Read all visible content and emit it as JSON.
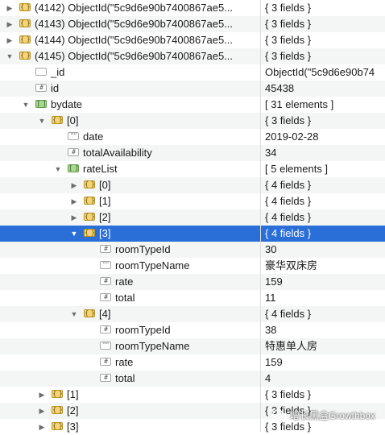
{
  "rows": [
    {
      "depth": 0,
      "arrow": "right",
      "icon": "obj",
      "key": "(4142) ObjectId(\"5c9d6e90b7400867ae5...",
      "val": "{ 3 fields }"
    },
    {
      "depth": 0,
      "arrow": "right",
      "icon": "obj",
      "key": "(4143) ObjectId(\"5c9d6e90b7400867ae5...",
      "val": "{ 3 fields }"
    },
    {
      "depth": 0,
      "arrow": "right",
      "icon": "obj",
      "key": "(4144) ObjectId(\"5c9d6e90b7400867ae5...",
      "val": "{ 3 fields }"
    },
    {
      "depth": 0,
      "arrow": "down",
      "icon": "obj",
      "key": "(4145) ObjectId(\"5c9d6e90b7400867ae5...",
      "val": "{ 3 fields }"
    },
    {
      "depth": 1,
      "arrow": "none",
      "icon": "oid",
      "key": "_id",
      "val": "ObjectId(\"5c9d6e90b74"
    },
    {
      "depth": 1,
      "arrow": "none",
      "icon": "num",
      "key": "id",
      "val": "45438"
    },
    {
      "depth": 1,
      "arrow": "down",
      "icon": "arr",
      "key": "bydate",
      "val": "[ 31 elements ]"
    },
    {
      "depth": 2,
      "arrow": "down",
      "icon": "obj",
      "key": "[0]",
      "val": "{ 3 fields }"
    },
    {
      "depth": 3,
      "arrow": "none",
      "icon": "str",
      "key": "date",
      "val": "2019-02-28"
    },
    {
      "depth": 3,
      "arrow": "none",
      "icon": "num",
      "key": "totalAvailability",
      "val": "34"
    },
    {
      "depth": 3,
      "arrow": "down",
      "icon": "arr",
      "key": "rateList",
      "val": "[ 5 elements ]"
    },
    {
      "depth": 4,
      "arrow": "right",
      "icon": "obj",
      "key": "[0]",
      "val": "{ 4 fields }"
    },
    {
      "depth": 4,
      "arrow": "right",
      "icon": "obj",
      "key": "[1]",
      "val": "{ 4 fields }"
    },
    {
      "depth": 4,
      "arrow": "right",
      "icon": "obj",
      "key": "[2]",
      "val": "{ 4 fields }"
    },
    {
      "depth": 4,
      "arrow": "down",
      "icon": "obj",
      "key": "[3]",
      "val": "{ 4 fields }",
      "selected": true
    },
    {
      "depth": 5,
      "arrow": "none",
      "icon": "num",
      "key": "roomTypeId",
      "val": "30"
    },
    {
      "depth": 5,
      "arrow": "none",
      "icon": "str",
      "key": "roomTypeName",
      "val": "豪华双床房"
    },
    {
      "depth": 5,
      "arrow": "none",
      "icon": "num",
      "key": "rate",
      "val": "159"
    },
    {
      "depth": 5,
      "arrow": "none",
      "icon": "num",
      "key": "total",
      "val": "11"
    },
    {
      "depth": 4,
      "arrow": "down",
      "icon": "obj",
      "key": "[4]",
      "val": "{ 4 fields }"
    },
    {
      "depth": 5,
      "arrow": "none",
      "icon": "num",
      "key": "roomTypeId",
      "val": "38"
    },
    {
      "depth": 5,
      "arrow": "none",
      "icon": "str",
      "key": "roomTypeName",
      "val": "特惠单人房"
    },
    {
      "depth": 5,
      "arrow": "none",
      "icon": "num",
      "key": "rate",
      "val": "159"
    },
    {
      "depth": 5,
      "arrow": "none",
      "icon": "num",
      "key": "total",
      "val": "4"
    },
    {
      "depth": 2,
      "arrow": "right",
      "icon": "obj",
      "key": "[1]",
      "val": "{ 3 fields }"
    },
    {
      "depth": 2,
      "arrow": "right",
      "icon": "obj",
      "key": "[2]",
      "val": "{ 3 fields }"
    },
    {
      "depth": 2,
      "arrow": "right",
      "icon": "obj",
      "key": "[3]",
      "val": "{ 3 fields }"
    }
  ],
  "icon_glyphs": {
    "obj": "{ }",
    "arr": "[ ]",
    "str": "\"\"",
    "num": "#",
    "oid": ""
  },
  "watermark": "增长黑盒Growthbox",
  "colors": {
    "selection": "#2a6fd7",
    "object_icon": "#f3d47a",
    "array_icon": "#a8d795"
  }
}
